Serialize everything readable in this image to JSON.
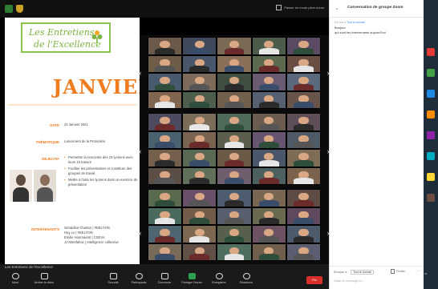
{
  "window": {
    "fullscreen_label": "Passer en mode plein écran"
  },
  "slide": {
    "brand_line1": "Les Entretiens",
    "brand_line2": "de l'Excellence",
    "month": "JANVIER",
    "rows": [
      {
        "label": "DATE",
        "value": "22 Janvier 2021"
      },
      {
        "label": "THÉMATIQUE",
        "value": "Lancement de la Promotion"
      },
      {
        "label": "OBJECTIF",
        "bullets": [
          "Permettre la rencontre des 15 lycéens avec leurs 15 tuteurs",
          "Faciliter les présentations et constituer des groupes de travail",
          "Mettre à l'aise les lycéens dans un exercice de présentation"
        ]
      },
      {
        "label": "INTERVENANTS",
        "lines": [
          "Géraldine Charton | #EELYON",
          "Huy Le | #EELYON",
          "Emilie Hoornaerst | CSEVA",
          "JJ Montfahuc | Intelligence collective"
        ]
      }
    ],
    "photo_colors": [
      "#5c4b3f",
      "#8a6d58"
    ]
  },
  "gallery": {
    "tile_colors": [
      "#6b5a4a",
      "#3e4a5c",
      "#7a6a55",
      "#4b5d4a",
      "#5a4a62",
      "#6e5c48",
      "#48586a",
      "#8a7058",
      "#5c6a52",
      "#6a4e44",
      "#4a5a6e",
      "#7c6a5a",
      "#3f4e40",
      "#6a5a72",
      "#5a6a7c",
      "#806650",
      "#4e5e4c",
      "#72604e",
      "#556070",
      "#68544a",
      "#4c4a5e",
      "#7a6e5a",
      "#506a5a",
      "#6a5c4e",
      "#5e4e58",
      "#4a6270",
      "#786450",
      "#5a5e4a",
      "#665470",
      "#4e5a66",
      "#74604c",
      "#586a54",
      "#6c5a48",
      "#4a566a",
      "#7e6c56",
      "#5a4e46",
      "#60705a",
      "#6e5e6e",
      "#4c6060",
      "#7a624c",
      "#5a6a4e",
      "#685068",
      "#4e5c70",
      "#766652",
      "#5c4c44",
      "#4a6a5e",
      "#725c4a",
      "#586070",
      "#6a6a50",
      "#5e4a5c",
      "#4e6672",
      "#7c6850",
      "#56604c",
      "#6c5262",
      "#4c5a6c",
      "#786a58",
      "#605048",
      "#4e6e60",
      "#705e4c",
      "#5a5e70"
    ],
    "shirt_colors": [
      "#2b2b2b",
      "#394d6b",
      "#6b2b2b",
      "#e6e6e6",
      "#2e4d3a",
      "#555555"
    ]
  },
  "controls": {
    "meeting_title": "Les Entretiens de l'Excellence",
    "buttons": [
      {
        "label": "Muet",
        "icon": "microphone-icon"
      },
      {
        "label": "Arrêter la vidéo",
        "icon": "video-camera-icon"
      },
      {
        "label": "Sécurité",
        "icon": "shield-icon"
      },
      {
        "label": "Participants",
        "icon": "participants-icon"
      },
      {
        "label": "Converser",
        "icon": "chat-icon"
      },
      {
        "label": "Partager l'écran",
        "icon": "share-screen-icon"
      },
      {
        "label": "Enregistrer",
        "icon": "record-icon"
      },
      {
        "label": "Réactions",
        "icon": "reactions-icon"
      }
    ],
    "end_label": "Fin"
  },
  "chat": {
    "title": "Conversation de groupe Zoom",
    "sender": "De moi à",
    "recipient": "Tout le monde",
    "messages": [
      "Bonjour",
      "qui sont les intervenants aujourd'hui"
    ],
    "to_label": "Envoyer à :",
    "to_value": "Tout le monde",
    "file_label": "Fichier",
    "more_label": "···",
    "compose_placeholder": "Saisir le message ici..."
  },
  "taskbar": {
    "icon_colors": [
      "#e53935",
      "#43a047",
      "#1e88e5",
      "#fb8c00",
      "#8e24aa",
      "#00acc1",
      "#fdd835",
      "#6d4c41"
    ],
    "time": "16:"
  }
}
